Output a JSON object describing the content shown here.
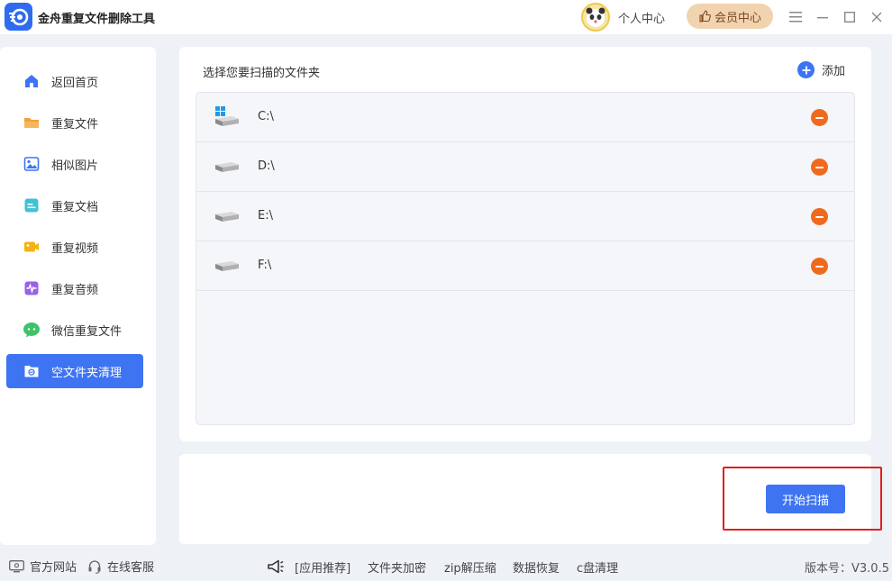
{
  "titlebar": {
    "app_title": "金舟重复文件删除工具",
    "personal_center": "个人中心",
    "vip_center": "会员中心"
  },
  "sidebar": {
    "items": [
      {
        "label": "返回首页",
        "icon": "home-icon",
        "color": "#3e74f2"
      },
      {
        "label": "重复文件",
        "icon": "folder-icon",
        "color": "#f5a03a"
      },
      {
        "label": "相似图片",
        "icon": "image-icon",
        "color": "#3e74f2"
      },
      {
        "label": "重复文档",
        "icon": "document-icon",
        "color": "#3ec3d4"
      },
      {
        "label": "重复视频",
        "icon": "video-icon",
        "color": "#f5b312"
      },
      {
        "label": "重复音频",
        "icon": "audio-icon",
        "color": "#9b62e6"
      },
      {
        "label": "微信重复文件",
        "icon": "wechat-icon",
        "color": "#3ec26a"
      },
      {
        "label": "空文件夹清理",
        "icon": "empty-folder-icon",
        "color": "#ffffff"
      }
    ],
    "active_index": 7
  },
  "main": {
    "title": "选择您要扫描的文件夹",
    "add_label": "添加",
    "folders": [
      {
        "path": "C:\\",
        "icon": "windows-drive-icon"
      },
      {
        "path": "D:\\",
        "icon": "drive-icon"
      },
      {
        "path": "E:\\",
        "icon": "drive-icon"
      },
      {
        "path": "F:\\",
        "icon": "drive-icon"
      }
    ]
  },
  "action": {
    "scan_label": "开始扫描"
  },
  "footer": {
    "website": "官方网站",
    "support": "在线客服",
    "recommend": "[应用推荐]",
    "links": [
      "文件夹加密",
      "zip解压缩",
      "数据恢复",
      "c盘清理"
    ],
    "version": "版本号：V3.0.5"
  },
  "colors": {
    "accent": "#3e74f2",
    "remove": "#f06a1e",
    "highlight": "#e0201d",
    "vip_bg": "#f2d3b0"
  }
}
